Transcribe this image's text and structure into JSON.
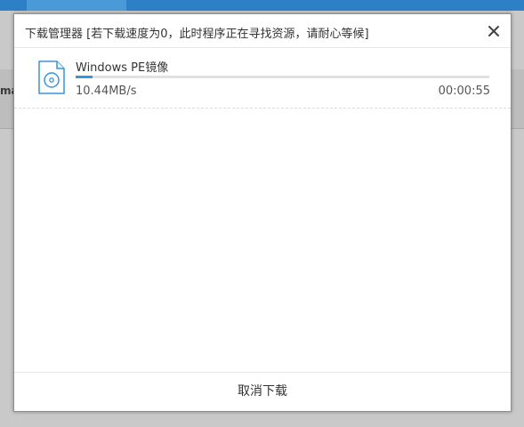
{
  "background": {
    "partial_text": "ma"
  },
  "dialog": {
    "title": "下载管理器 [若下载速度为0，此时程序正在寻找资源，请耐心等候]",
    "close_icon": "close-icon",
    "download": {
      "file_icon": "disc-file-icon",
      "file_name": "Windows PE镜像",
      "progress_percent": 4,
      "speed": "10.44MB/s",
      "elapsed_time": "00:00:55"
    },
    "cancel_label": "取消下载"
  },
  "colors": {
    "accent": "#3a94d8",
    "app_bar": "#2d7fc6"
  }
}
